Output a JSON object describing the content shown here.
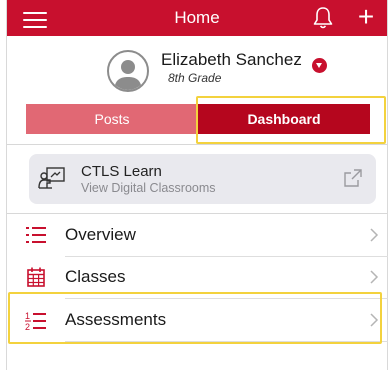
{
  "header": {
    "title": "Home",
    "icons": {
      "menu": "hamburger-menu-icon",
      "notifications": "bell-icon",
      "add": "plus-icon"
    },
    "add_glyph": "+"
  },
  "profile": {
    "name": "Elizabeth Sanchez",
    "grade": "8th Grade"
  },
  "tabs": [
    {
      "label": "Posts",
      "selected": false
    },
    {
      "label": "Dashboard",
      "selected": true
    }
  ],
  "ctls_card": {
    "title": "CTLS Learn",
    "subtitle": "View Digital Classrooms",
    "icon": "digital-classroom-icon",
    "action_icon": "external-link-icon"
  },
  "menu_items": [
    {
      "label": "Overview",
      "icon": "list-icon"
    },
    {
      "label": "Classes",
      "icon": "calendar-icon"
    },
    {
      "label": "Assessments",
      "icon": "numbered-list-icon"
    }
  ],
  "colors": {
    "brand_red": "#c8102e",
    "tab_inactive": "#e16874",
    "tab_active": "#b5061e",
    "highlight": "#f3d23e",
    "card_bg": "#e9e9ee"
  }
}
